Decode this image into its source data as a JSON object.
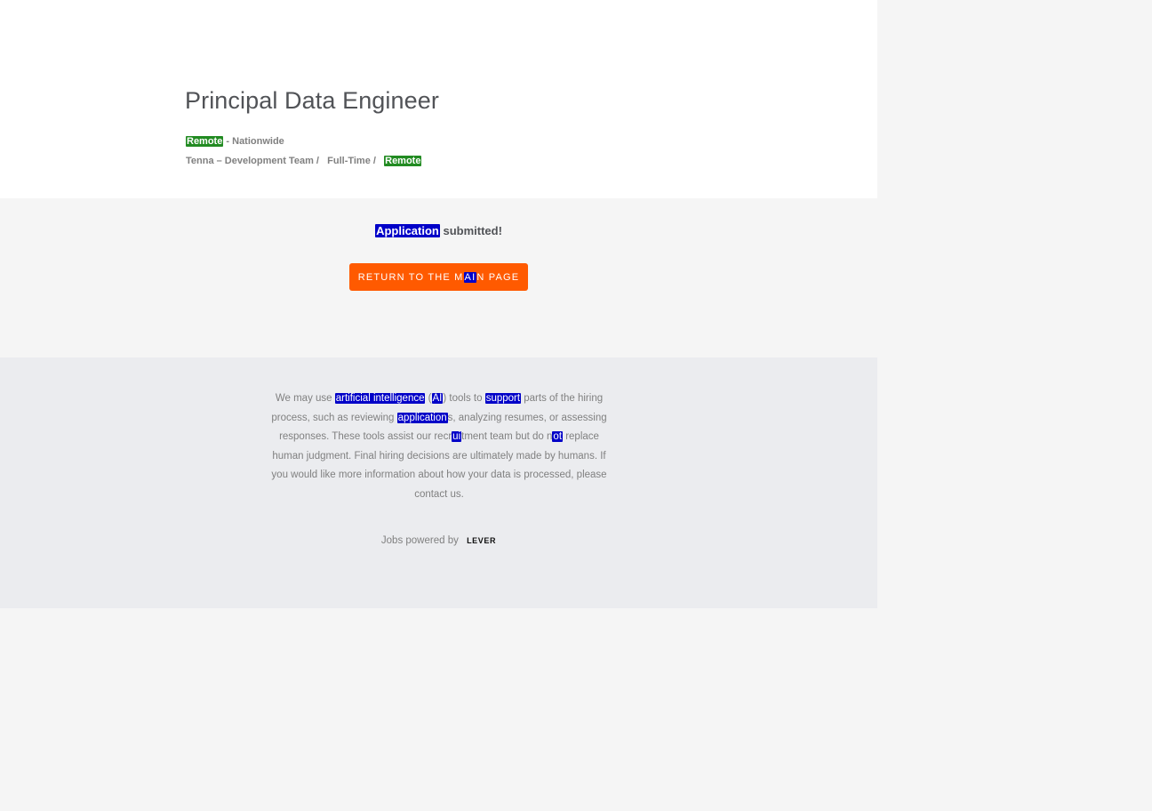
{
  "posting": {
    "title": "Principal Data Engineer",
    "location_highlight": "Remote",
    "location_rest": " - Nationwide",
    "team": "Tenna – Development Team /",
    "commitment": "Full-Time /",
    "workplace": "Remote"
  },
  "confirmation": {
    "submitted_highlight": "Application",
    "submitted_rest": " submitted!",
    "button_before": "RETURN TO THE M",
    "button_highlight": "AI",
    "button_after": "N PAGE"
  },
  "footer": {
    "disclaimer": {
      "p1": "We may use ",
      "h1": "artificial intelligence",
      "p2": " (",
      "h2": "AI",
      "p3": ") tools to ",
      "h3": "support",
      "p4": " parts of the hiring process, such as reviewing ",
      "h4": "application",
      "p5": "s, analyzing resumes, or assessing responses. These tools assist our recr",
      "h5": "ui",
      "p6": "tment team but do n",
      "h6": "ot",
      "p7": " replace human judgment. Final hiring decisions are ultimately made by humans. If you would like more information about how your data is processed, please contact us."
    },
    "powered_by": "Jobs powered by",
    "logo_text": "LEVER"
  },
  "colors": {
    "accent_button": "#ff5a00",
    "highlight_green": "#228b22",
    "highlight_blue": "#0000c8"
  }
}
